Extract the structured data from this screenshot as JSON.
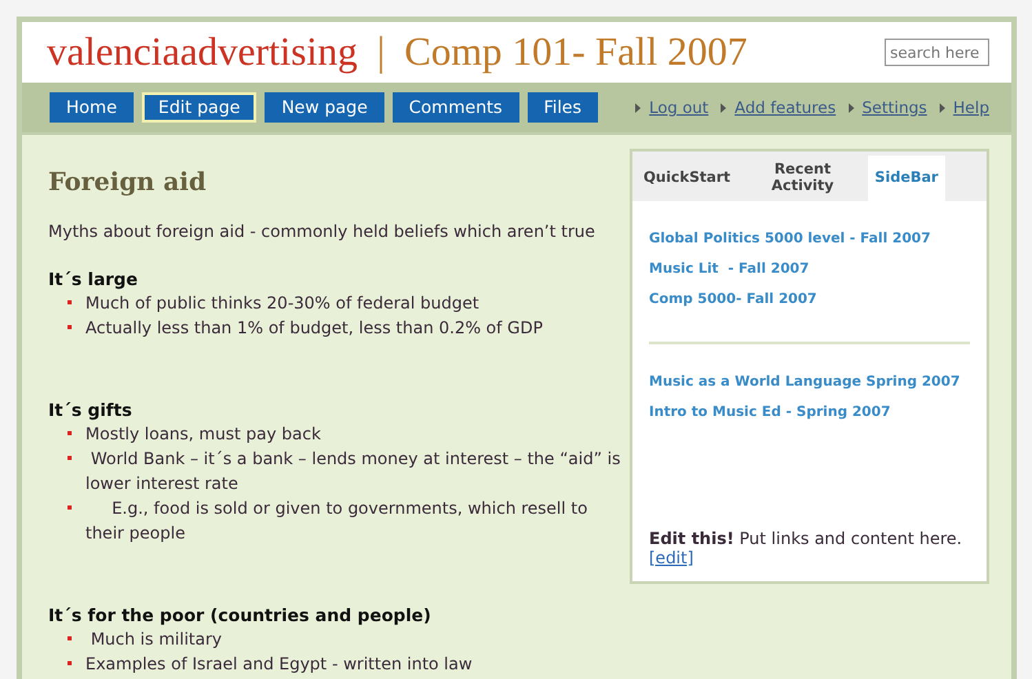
{
  "header": {
    "site_name": "valenciaadvertising",
    "divider": "|",
    "page_title": "Comp 101- Fall 2007",
    "search": {
      "placeholder": "search here"
    }
  },
  "nav": {
    "buttons": [
      {
        "label": "Home",
        "selected": false
      },
      {
        "label": "Edit page",
        "selected": true
      },
      {
        "label": "New page",
        "selected": false
      },
      {
        "label": "Comments",
        "selected": false
      },
      {
        "label": "Files",
        "selected": false
      }
    ],
    "links": [
      "Log out",
      "Add features",
      "Settings",
      "Help"
    ]
  },
  "article": {
    "title": "Foreign aid",
    "intro": "Myths about foreign aid - commonly held beliefs which aren’t true",
    "sections": [
      {
        "heading": "It´s large",
        "bullets": [
          "Much of public thinks 20-30% of federal budget",
          "Actually less than 1% of budget, less than 0.2% of GDP"
        ]
      },
      {
        "heading": "It´s gifts",
        "bullets": [
          "Mostly loans, must pay back",
          " World Bank – it´s a bank – lends money at interest – the “aid” is lower interest rate",
          "     E.g., food is sold or given to governments, which resell to their people"
        ]
      },
      {
        "heading": "It´s for the poor (countries and people)",
        "bullets": [
          " Much is military",
          "Examples of Israel and Egypt - written into law"
        ]
      }
    ]
  },
  "sidebar": {
    "tabs": [
      {
        "label": "QuickStart",
        "selected": false
      },
      {
        "label": "Recent Activity",
        "selected": false
      },
      {
        "label": "SideBar",
        "selected": true
      }
    ],
    "link_groups": [
      [
        "Global Politics 5000 level - Fall 2007",
        "Music Lit  - Fall 2007",
        "Comp 5000- Fall 2007"
      ],
      [
        "Music as a World Language Spring 2007",
        "Intro to Music Ed - Spring 2007"
      ]
    ],
    "note": "**Edit this!** Put links and content here.",
    "edit_link": "[edit]"
  }
}
